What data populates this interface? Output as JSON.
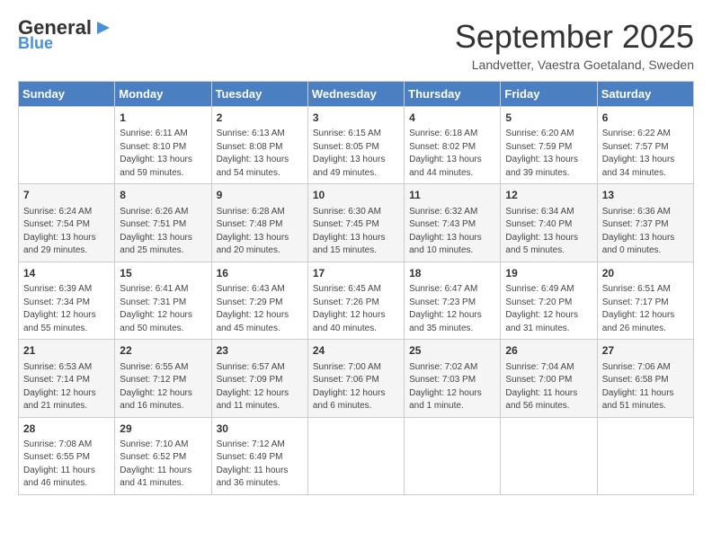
{
  "header": {
    "logo_general": "General",
    "logo_blue": "Blue",
    "month": "September 2025",
    "location": "Landvetter, Vaestra Goetaland, Sweden"
  },
  "days_of_week": [
    "Sunday",
    "Monday",
    "Tuesday",
    "Wednesday",
    "Thursday",
    "Friday",
    "Saturday"
  ],
  "weeks": [
    [
      {
        "day": "",
        "content": ""
      },
      {
        "day": "1",
        "content": "Sunrise: 6:11 AM\nSunset: 8:10 PM\nDaylight: 13 hours\nand 59 minutes."
      },
      {
        "day": "2",
        "content": "Sunrise: 6:13 AM\nSunset: 8:08 PM\nDaylight: 13 hours\nand 54 minutes."
      },
      {
        "day": "3",
        "content": "Sunrise: 6:15 AM\nSunset: 8:05 PM\nDaylight: 13 hours\nand 49 minutes."
      },
      {
        "day": "4",
        "content": "Sunrise: 6:18 AM\nSunset: 8:02 PM\nDaylight: 13 hours\nand 44 minutes."
      },
      {
        "day": "5",
        "content": "Sunrise: 6:20 AM\nSunset: 7:59 PM\nDaylight: 13 hours\nand 39 minutes."
      },
      {
        "day": "6",
        "content": "Sunrise: 6:22 AM\nSunset: 7:57 PM\nDaylight: 13 hours\nand 34 minutes."
      }
    ],
    [
      {
        "day": "7",
        "content": "Sunrise: 6:24 AM\nSunset: 7:54 PM\nDaylight: 13 hours\nand 29 minutes."
      },
      {
        "day": "8",
        "content": "Sunrise: 6:26 AM\nSunset: 7:51 PM\nDaylight: 13 hours\nand 25 minutes."
      },
      {
        "day": "9",
        "content": "Sunrise: 6:28 AM\nSunset: 7:48 PM\nDaylight: 13 hours\nand 20 minutes."
      },
      {
        "day": "10",
        "content": "Sunrise: 6:30 AM\nSunset: 7:45 PM\nDaylight: 13 hours\nand 15 minutes."
      },
      {
        "day": "11",
        "content": "Sunrise: 6:32 AM\nSunset: 7:43 PM\nDaylight: 13 hours\nand 10 minutes."
      },
      {
        "day": "12",
        "content": "Sunrise: 6:34 AM\nSunset: 7:40 PM\nDaylight: 13 hours\nand 5 minutes."
      },
      {
        "day": "13",
        "content": "Sunrise: 6:36 AM\nSunset: 7:37 PM\nDaylight: 13 hours\nand 0 minutes."
      }
    ],
    [
      {
        "day": "14",
        "content": "Sunrise: 6:39 AM\nSunset: 7:34 PM\nDaylight: 12 hours\nand 55 minutes."
      },
      {
        "day": "15",
        "content": "Sunrise: 6:41 AM\nSunset: 7:31 PM\nDaylight: 12 hours\nand 50 minutes."
      },
      {
        "day": "16",
        "content": "Sunrise: 6:43 AM\nSunset: 7:29 PM\nDaylight: 12 hours\nand 45 minutes."
      },
      {
        "day": "17",
        "content": "Sunrise: 6:45 AM\nSunset: 7:26 PM\nDaylight: 12 hours\nand 40 minutes."
      },
      {
        "day": "18",
        "content": "Sunrise: 6:47 AM\nSunset: 7:23 PM\nDaylight: 12 hours\nand 35 minutes."
      },
      {
        "day": "19",
        "content": "Sunrise: 6:49 AM\nSunset: 7:20 PM\nDaylight: 12 hours\nand 31 minutes."
      },
      {
        "day": "20",
        "content": "Sunrise: 6:51 AM\nSunset: 7:17 PM\nDaylight: 12 hours\nand 26 minutes."
      }
    ],
    [
      {
        "day": "21",
        "content": "Sunrise: 6:53 AM\nSunset: 7:14 PM\nDaylight: 12 hours\nand 21 minutes."
      },
      {
        "day": "22",
        "content": "Sunrise: 6:55 AM\nSunset: 7:12 PM\nDaylight: 12 hours\nand 16 minutes."
      },
      {
        "day": "23",
        "content": "Sunrise: 6:57 AM\nSunset: 7:09 PM\nDaylight: 12 hours\nand 11 minutes."
      },
      {
        "day": "24",
        "content": "Sunrise: 7:00 AM\nSunset: 7:06 PM\nDaylight: 12 hours\nand 6 minutes."
      },
      {
        "day": "25",
        "content": "Sunrise: 7:02 AM\nSunset: 7:03 PM\nDaylight: 12 hours\nand 1 minute."
      },
      {
        "day": "26",
        "content": "Sunrise: 7:04 AM\nSunset: 7:00 PM\nDaylight: 11 hours\nand 56 minutes."
      },
      {
        "day": "27",
        "content": "Sunrise: 7:06 AM\nSunset: 6:58 PM\nDaylight: 11 hours\nand 51 minutes."
      }
    ],
    [
      {
        "day": "28",
        "content": "Sunrise: 7:08 AM\nSunset: 6:55 PM\nDaylight: 11 hours\nand 46 minutes."
      },
      {
        "day": "29",
        "content": "Sunrise: 7:10 AM\nSunset: 6:52 PM\nDaylight: 11 hours\nand 41 minutes."
      },
      {
        "day": "30",
        "content": "Sunrise: 7:12 AM\nSunset: 6:49 PM\nDaylight: 11 hours\nand 36 minutes."
      },
      {
        "day": "",
        "content": ""
      },
      {
        "day": "",
        "content": ""
      },
      {
        "day": "",
        "content": ""
      },
      {
        "day": "",
        "content": ""
      }
    ]
  ]
}
